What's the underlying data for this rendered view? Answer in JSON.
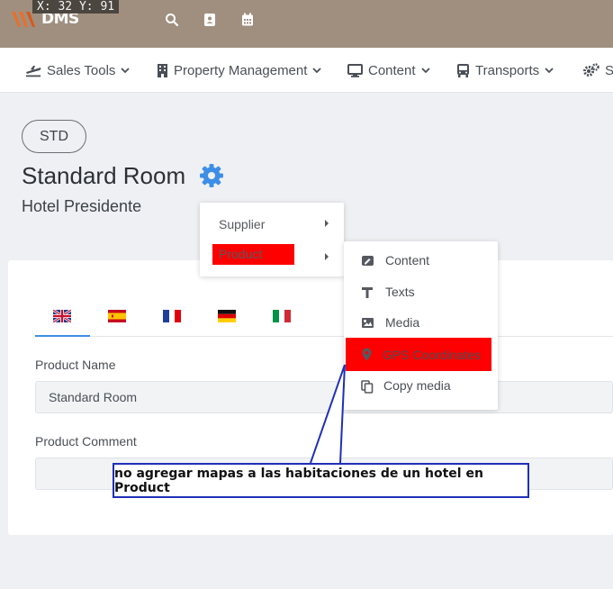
{
  "topbar": {
    "coords": "X: 32 Y: 91",
    "logo_text": "DMS",
    "icons": [
      "search-icon",
      "address-book-icon",
      "calendar-icon"
    ]
  },
  "nav": {
    "items": [
      {
        "label": "Sales Tools",
        "icon": "plane-icon"
      },
      {
        "label": "Property Management",
        "icon": "building-icon"
      },
      {
        "label": "Content",
        "icon": "monitor-icon"
      },
      {
        "label": "Transports",
        "icon": "bus-icon"
      },
      {
        "label": "Sy",
        "icon": "gears-icon"
      }
    ]
  },
  "header": {
    "badge": "STD",
    "title": "Standard Room",
    "subtitle": "Hotel Presidente"
  },
  "languages": [
    "English",
    "Spanish",
    "French",
    "German",
    "Italian"
  ],
  "form": {
    "product_name_label": "Product Name",
    "product_name_value": "Standard Room",
    "product_comment_label": "Product Comment",
    "product_comment_value": ""
  },
  "context_menu": {
    "items": [
      "Supplier",
      "Product"
    ],
    "highlighted": "Product"
  },
  "submenu": {
    "items": [
      {
        "label": "Content",
        "icon": "edit-square-icon"
      },
      {
        "label": "Texts",
        "icon": "text-icon"
      },
      {
        "label": "Media",
        "icon": "image-icon"
      },
      {
        "label": "GPS Coordinates",
        "icon": "map-marker-icon"
      },
      {
        "label": "Copy media",
        "icon": "copy-icon"
      }
    ],
    "highlighted": "GPS Coordinates"
  },
  "annotation": {
    "text": "no agregar mapas a las habitaciones de un hotel en Product"
  },
  "colors": {
    "topbar": "#a08f7f",
    "accent": "#3d8ee6",
    "highlight": "#ff0000",
    "annotation_border": "#1f2fb8"
  }
}
